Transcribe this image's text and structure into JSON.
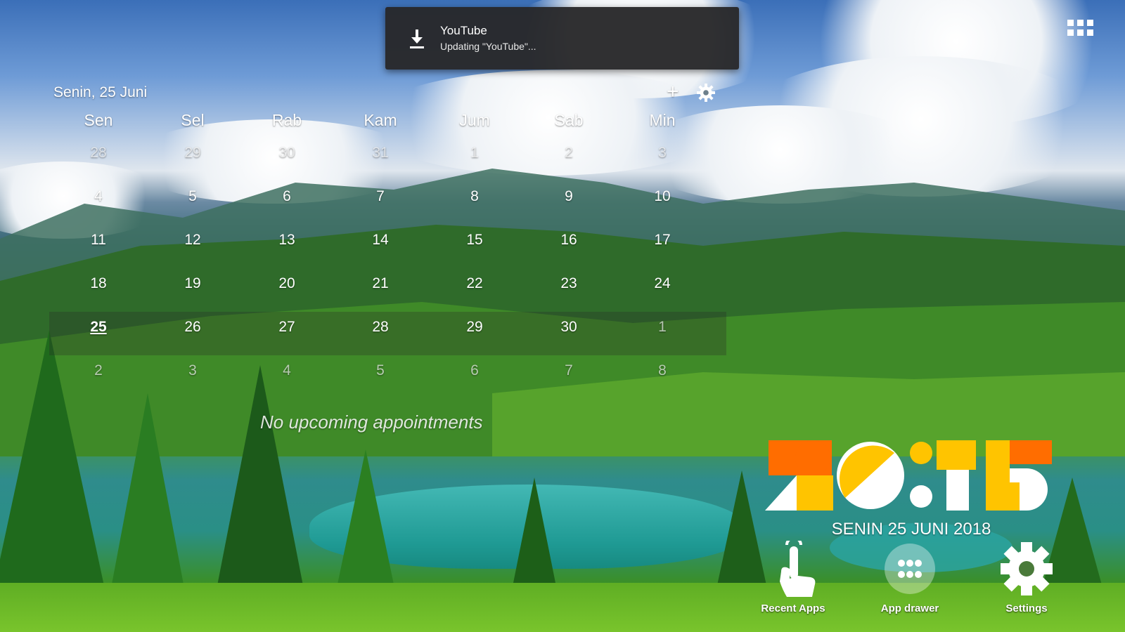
{
  "notification": {
    "app": "YouTube",
    "message": "Updating \"YouTube\"...",
    "icon": "download-icon"
  },
  "calendar": {
    "weekday_label": "Senin,",
    "date_label": "25 Juni",
    "add_icon": "plus-icon",
    "settings_icon": "gear-icon",
    "weekdays": [
      "Sen",
      "Sel",
      "Rab",
      "Kam",
      "Jum",
      "Sab",
      "Min"
    ],
    "weeks": [
      [
        "28",
        "29",
        "30",
        "31",
        "1",
        "2",
        "3"
      ],
      [
        "4",
        "5",
        "6",
        "7",
        "8",
        "9",
        "10"
      ],
      [
        "11",
        "12",
        "13",
        "14",
        "15",
        "16",
        "17"
      ],
      [
        "18",
        "19",
        "20",
        "21",
        "22",
        "23",
        "24"
      ],
      [
        "25",
        "26",
        "27",
        "28",
        "29",
        "30",
        "1"
      ],
      [
        "2",
        "3",
        "4",
        "5",
        "6",
        "7",
        "8"
      ]
    ],
    "today": "25",
    "empty_message": "No upcoming appointments"
  },
  "clock": {
    "time": "20:15",
    "date": "SENIN 25 JUNI 2018",
    "colors": {
      "orange": "#ff6d00",
      "yellow": "#ffc400",
      "white": "#ffffff"
    }
  },
  "dock": {
    "recent_apps": {
      "label": "Recent Apps",
      "icon": "touch-hand-icon"
    },
    "app_drawer": {
      "label": "App drawer",
      "icon": "dots-grid-icon"
    },
    "settings": {
      "label": "Settings",
      "icon": "gear-icon"
    }
  },
  "top_right": {
    "icon": "apps-grid-icon"
  }
}
